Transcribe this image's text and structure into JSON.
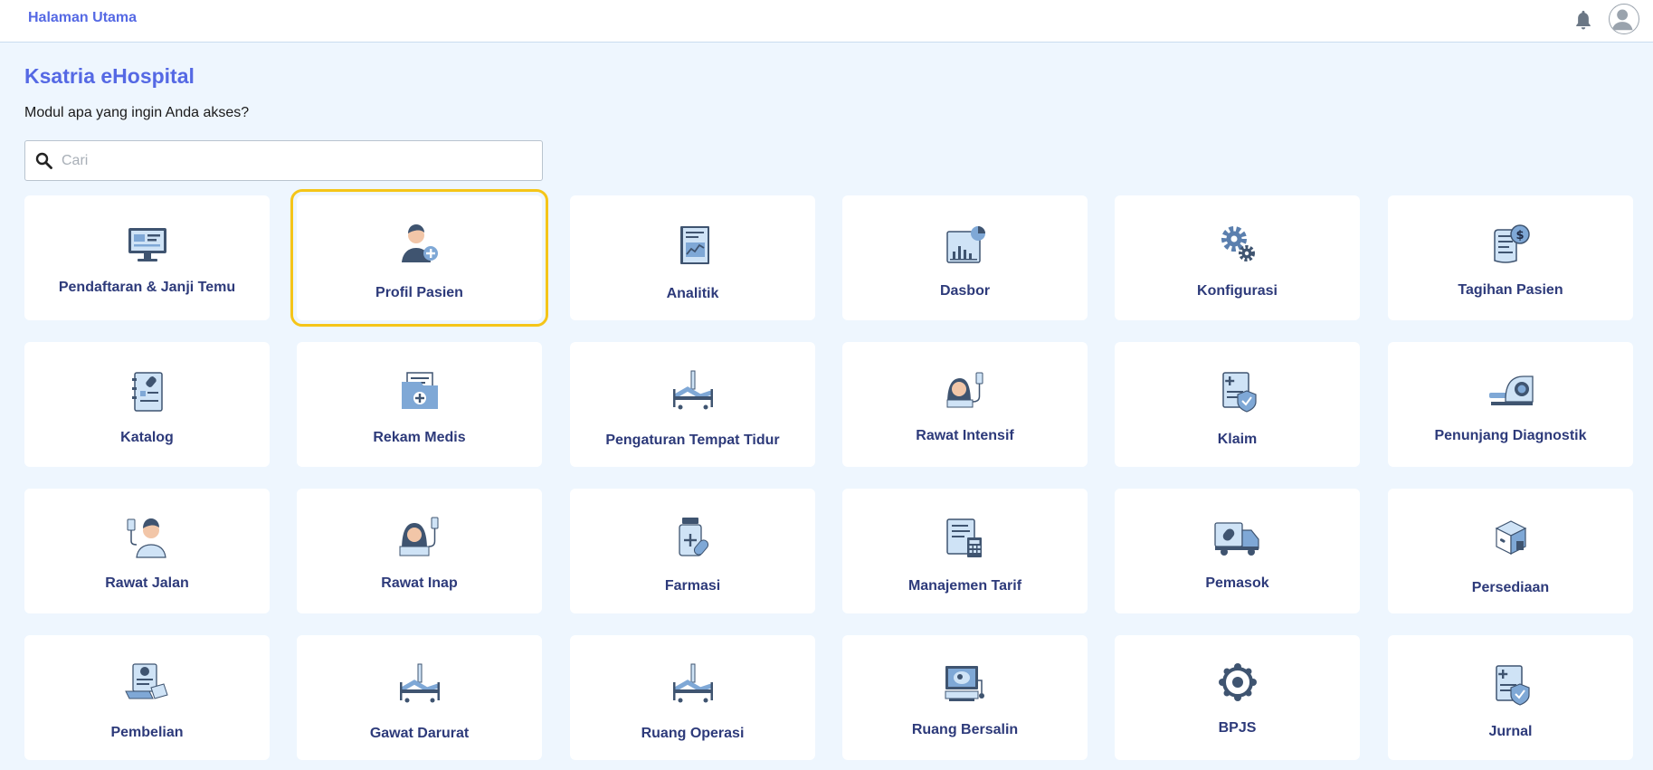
{
  "header": {
    "home_label": "Halaman Utama"
  },
  "page": {
    "title": "Ksatria eHospital",
    "subtitle": "Modul apa yang ingin Anda akses?"
  },
  "search": {
    "placeholder": "Cari",
    "value": ""
  },
  "colors": {
    "accent": "#5569e4",
    "label": "#2d3a7a",
    "selected_outline": "#f5c518",
    "background": "#eef6fe"
  },
  "modules": [
    {
      "label": "Pendaftaran & Janji Temu",
      "icon": "registration-monitor-icon"
    },
    {
      "label": "Profil Pasien",
      "icon": "patient-profile-icon",
      "selected": true
    },
    {
      "label": "Analitik",
      "icon": "analytics-book-icon"
    },
    {
      "label": "Dasbor",
      "icon": "dashboard-chart-icon"
    },
    {
      "label": "Konfigurasi",
      "icon": "gears-icon"
    },
    {
      "label": "Tagihan Pasien",
      "icon": "invoice-dollar-icon"
    },
    {
      "label": "Katalog",
      "icon": "catalog-icon"
    },
    {
      "label": "Rekam Medis",
      "icon": "medical-folder-icon"
    },
    {
      "label": "Pengaturan Tempat Tidur",
      "icon": "hospital-bed-icon"
    },
    {
      "label": "Rawat Intensif",
      "icon": "intensive-care-icon"
    },
    {
      "label": "Klaim",
      "icon": "claim-shield-icon"
    },
    {
      "label": "Penunjang Diagnostik",
      "icon": "ct-scanner-icon"
    },
    {
      "label": "Rawat Jalan",
      "icon": "outpatient-icon"
    },
    {
      "label": "Rawat Inap",
      "icon": "inpatient-icon"
    },
    {
      "label": "Farmasi",
      "icon": "pharmacy-icon"
    },
    {
      "label": "Manajemen Tarif",
      "icon": "tariff-calculator-icon"
    },
    {
      "label": "Pemasok",
      "icon": "supplier-truck-icon"
    },
    {
      "label": "Persediaan",
      "icon": "inventory-boxes-icon"
    },
    {
      "label": "Pembelian",
      "icon": "purchase-icon"
    },
    {
      "label": "Gawat Darurat",
      "icon": "emergency-bed-icon"
    },
    {
      "label": "Ruang Operasi",
      "icon": "operating-bed-icon"
    },
    {
      "label": "Ruang Bersalin",
      "icon": "maternity-monitor-icon"
    },
    {
      "label": "BPJS",
      "icon": "bpjs-logo-icon"
    },
    {
      "label": "Jurnal",
      "icon": "journal-shield-icon"
    }
  ]
}
